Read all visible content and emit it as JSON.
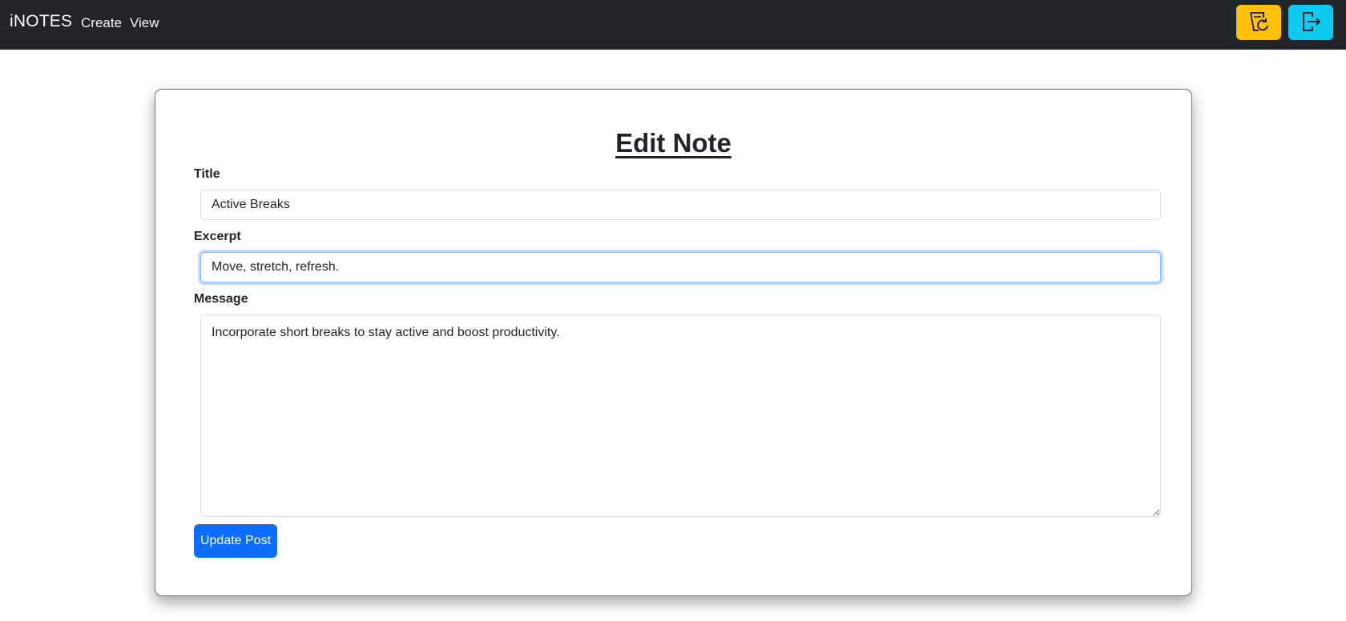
{
  "navbar": {
    "brand": "iNOTES",
    "links": [
      "Create",
      "View"
    ],
    "buttons": [
      {
        "icon": "reload-notes-icon",
        "color": "#ffc107"
      },
      {
        "icon": "logout-icon",
        "color": "#0dcaf0"
      }
    ],
    "background": "#212529"
  },
  "form": {
    "heading": "Edit Note",
    "title_label": "Title",
    "title_value": "Active Breaks",
    "excerpt_label": "Excerpt",
    "excerpt_value": "Move, stretch, refresh.",
    "message_label": "Message",
    "message_value": "Incorporate short breaks to stay active and boost productivity.",
    "submit_label": "Update Post",
    "submit_color": "#0d6efd"
  }
}
